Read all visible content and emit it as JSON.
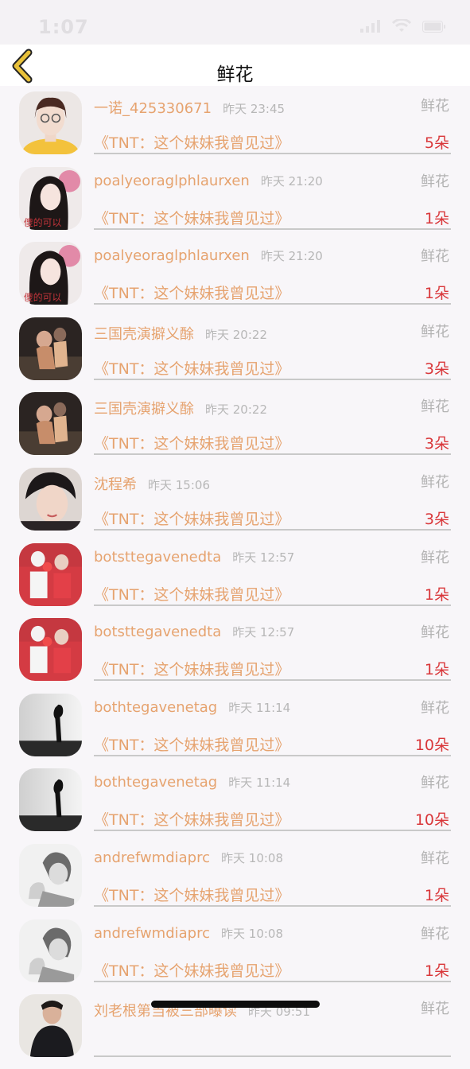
{
  "status": {
    "time": "1:07"
  },
  "nav": {
    "title": "鲜花"
  },
  "rows": [
    {
      "user": "一诺_425330671",
      "time": "昨天 23:45",
      "type": "鲜花",
      "book": "《TNT：这个妹妹我曾见过》",
      "count": "5朵",
      "avatar": "avatar-girl-glasses"
    },
    {
      "user": "poalyeoraglphlaurxen",
      "time": "昨天 21:20",
      "type": "鲜花",
      "book": "《TNT：这个妹妹我曾见过》",
      "count": "1朵",
      "avatar": "avatar-girl-flower"
    },
    {
      "user": "poalyeoraglphlaurxen",
      "time": "昨天 21:20",
      "type": "鲜花",
      "book": "《TNT：这个妹妹我曾见过》",
      "count": "1朵",
      "avatar": "avatar-girl-flower"
    },
    {
      "user": "三国壳演擗义酴",
      "time": "昨天 20:22",
      "type": "鲜花",
      "book": "《TNT：这个妹妹我曾见过》",
      "count": "3朵",
      "avatar": "avatar-couple-dark"
    },
    {
      "user": "三国壳演擗义酴",
      "time": "昨天 20:22",
      "type": "鲜花",
      "book": "《TNT：这个妹妹我曾见过》",
      "count": "3朵",
      "avatar": "avatar-couple-dark"
    },
    {
      "user": "沈程希",
      "time": "昨天 15:06",
      "type": "鲜花",
      "book": "《TNT：这个妹妹我曾见过》",
      "count": "3朵",
      "avatar": "avatar-boy-portrait"
    },
    {
      "user": "botsttegavenedta",
      "time": "昨天 12:57",
      "type": "鲜花",
      "book": "《TNT：这个妹妹我曾见过》",
      "count": "1朵",
      "avatar": "avatar-couple-red"
    },
    {
      "user": "botsttegavenedta",
      "time": "昨天 12:57",
      "type": "鲜花",
      "book": "《TNT：这个妹妹我曾见过》",
      "count": "1朵",
      "avatar": "avatar-couple-red"
    },
    {
      "user": "bothtegavenetag",
      "time": "昨天 11:14",
      "type": "鲜花",
      "book": "《TNT：这个妹妹我曾见过》",
      "count": "10朵",
      "avatar": "avatar-silhouette"
    },
    {
      "user": "bothtegavenetag",
      "time": "昨天 11:14",
      "type": "鲜花",
      "book": "《TNT：这个妹妹我曾见过》",
      "count": "10朵",
      "avatar": "avatar-silhouette"
    },
    {
      "user": "andrefwmdiaprc",
      "time": "昨天 10:08",
      "type": "鲜花",
      "book": "《TNT：这个妹妹我曾见过》",
      "count": "1朵",
      "avatar": "avatar-sketch"
    },
    {
      "user": "andrefwmdiaprc",
      "time": "昨天 10:08",
      "type": "鲜花",
      "book": "《TNT：这个妹妹我曾见过》",
      "count": "1朵",
      "avatar": "avatar-sketch"
    },
    {
      "user": "刘老根第当被三部曝读",
      "time": "昨天 09:51",
      "type": "鲜花",
      "book": "",
      "count": "",
      "avatar": "avatar-man-suit"
    }
  ],
  "colors": {
    "username": "#e6a36f",
    "count": "#d9373a",
    "back_arrow": "#e8c13a"
  }
}
